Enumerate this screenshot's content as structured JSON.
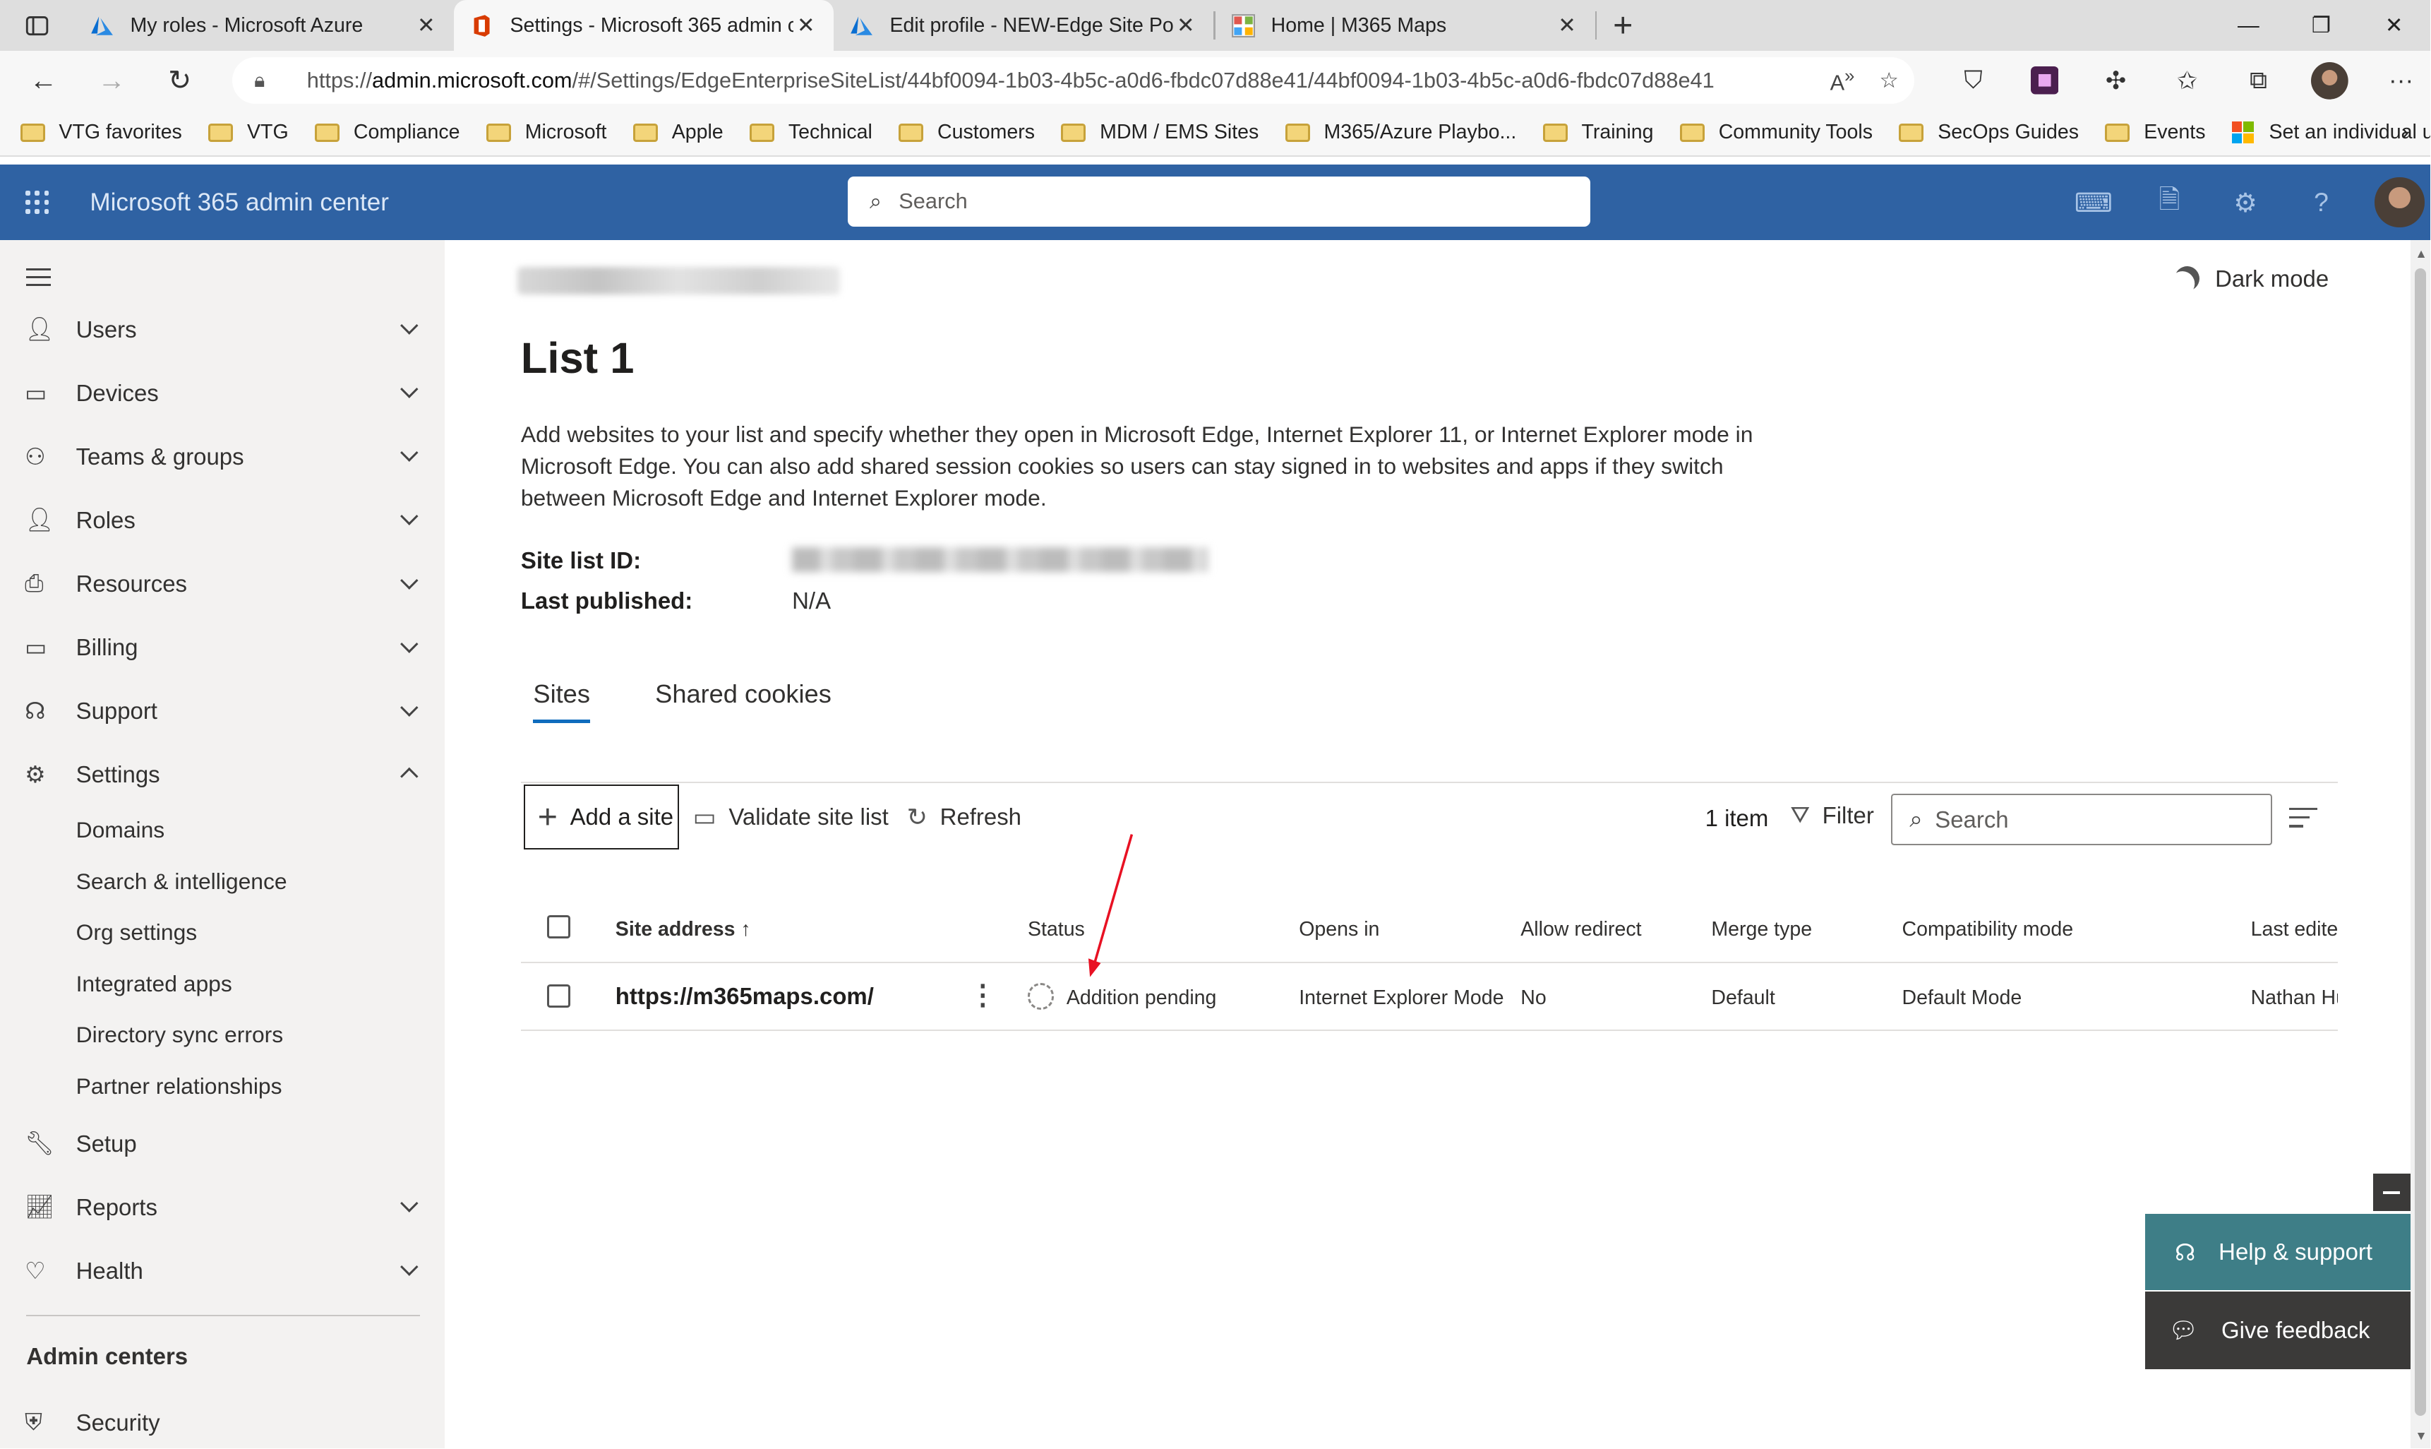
{
  "browser": {
    "tabs": [
      {
        "title": "My roles - Microsoft Azure",
        "icon": "azure-icon"
      },
      {
        "title": "Settings - Microsoft 365 admin c",
        "icon": "office-icon",
        "active": true
      },
      {
        "title": "Edit profile - NEW-Edge Site Poli",
        "icon": "azure-icon"
      },
      {
        "title": "Home | M365 Maps",
        "icon": "m365maps-icon"
      }
    ],
    "url_prefix": "https://",
    "url_domain": "admin.microsoft.com",
    "url_rest": "/#/Settings/EdgeEnterpriseSiteList/44bf0094-1b03-4b5c-a0d6-fbdc07d88e41/44bf0094-1b03-4b5c-a0d6-fbdc07d88e41",
    "bookmarks": [
      "VTG favorites",
      "VTG",
      "Compliance",
      "Microsoft",
      "Apple",
      "Technical",
      "Customers",
      "MDM / EMS Sites",
      "M365/Azure Playbo...",
      "Training",
      "Community Tools",
      "SecOps Guides",
      "Events",
      "Set an individual us..."
    ]
  },
  "suite": {
    "title": "Microsoft 365 admin center",
    "search_placeholder": "Search"
  },
  "nav": {
    "items": [
      "Users",
      "Devices",
      "Teams & groups",
      "Roles",
      "Resources",
      "Billing",
      "Support",
      "Settings"
    ],
    "settings_children": [
      "Domains",
      "Search & intelligence",
      "Org settings",
      "Integrated apps",
      "Directory sync errors",
      "Partner relationships"
    ],
    "items_after": [
      "Setup",
      "Reports",
      "Health"
    ],
    "admin_centers_heading": "Admin centers",
    "admin_centers": [
      "Security"
    ]
  },
  "page": {
    "dark_mode": "Dark mode",
    "title": "List 1",
    "description": "Add websites to your list and specify whether they open in Microsoft Edge, Internet Explorer 11, or Internet Explorer mode in Microsoft Edge. You can also add shared session cookies so users can stay signed in to websites and apps if they switch between Microsoft Edge and Internet Explorer mode.",
    "site_list_id_label": "Site list ID:",
    "last_published_label": "Last published:",
    "last_published_value": "N/A",
    "tabs": [
      "Sites",
      "Shared cookies"
    ]
  },
  "toolbar": {
    "add": "Add a site",
    "validate": "Validate site list",
    "refresh": "Refresh",
    "count": "1 item",
    "filter": "Filter",
    "search_placeholder": "Search"
  },
  "table": {
    "headers": [
      "Site address",
      "Status",
      "Opens in",
      "Allow redirect",
      "Merge type",
      "Compatibility mode",
      "Last edited"
    ],
    "rows": [
      {
        "site": "https://m365maps.com/",
        "status": "Addition pending",
        "opens_in": "Internet Explorer Mode",
        "allow_redirect": "No",
        "merge_type": "Default",
        "compat": "Default Mode",
        "last_edited": "Nathan Hutchinson"
      }
    ]
  },
  "floating": {
    "help": "Help & support",
    "feedback": "Give feedback"
  },
  "colors": {
    "suite_bar": "#2f62a3",
    "help_button": "#3e7e87",
    "annotation_arrow": "#e81123"
  }
}
